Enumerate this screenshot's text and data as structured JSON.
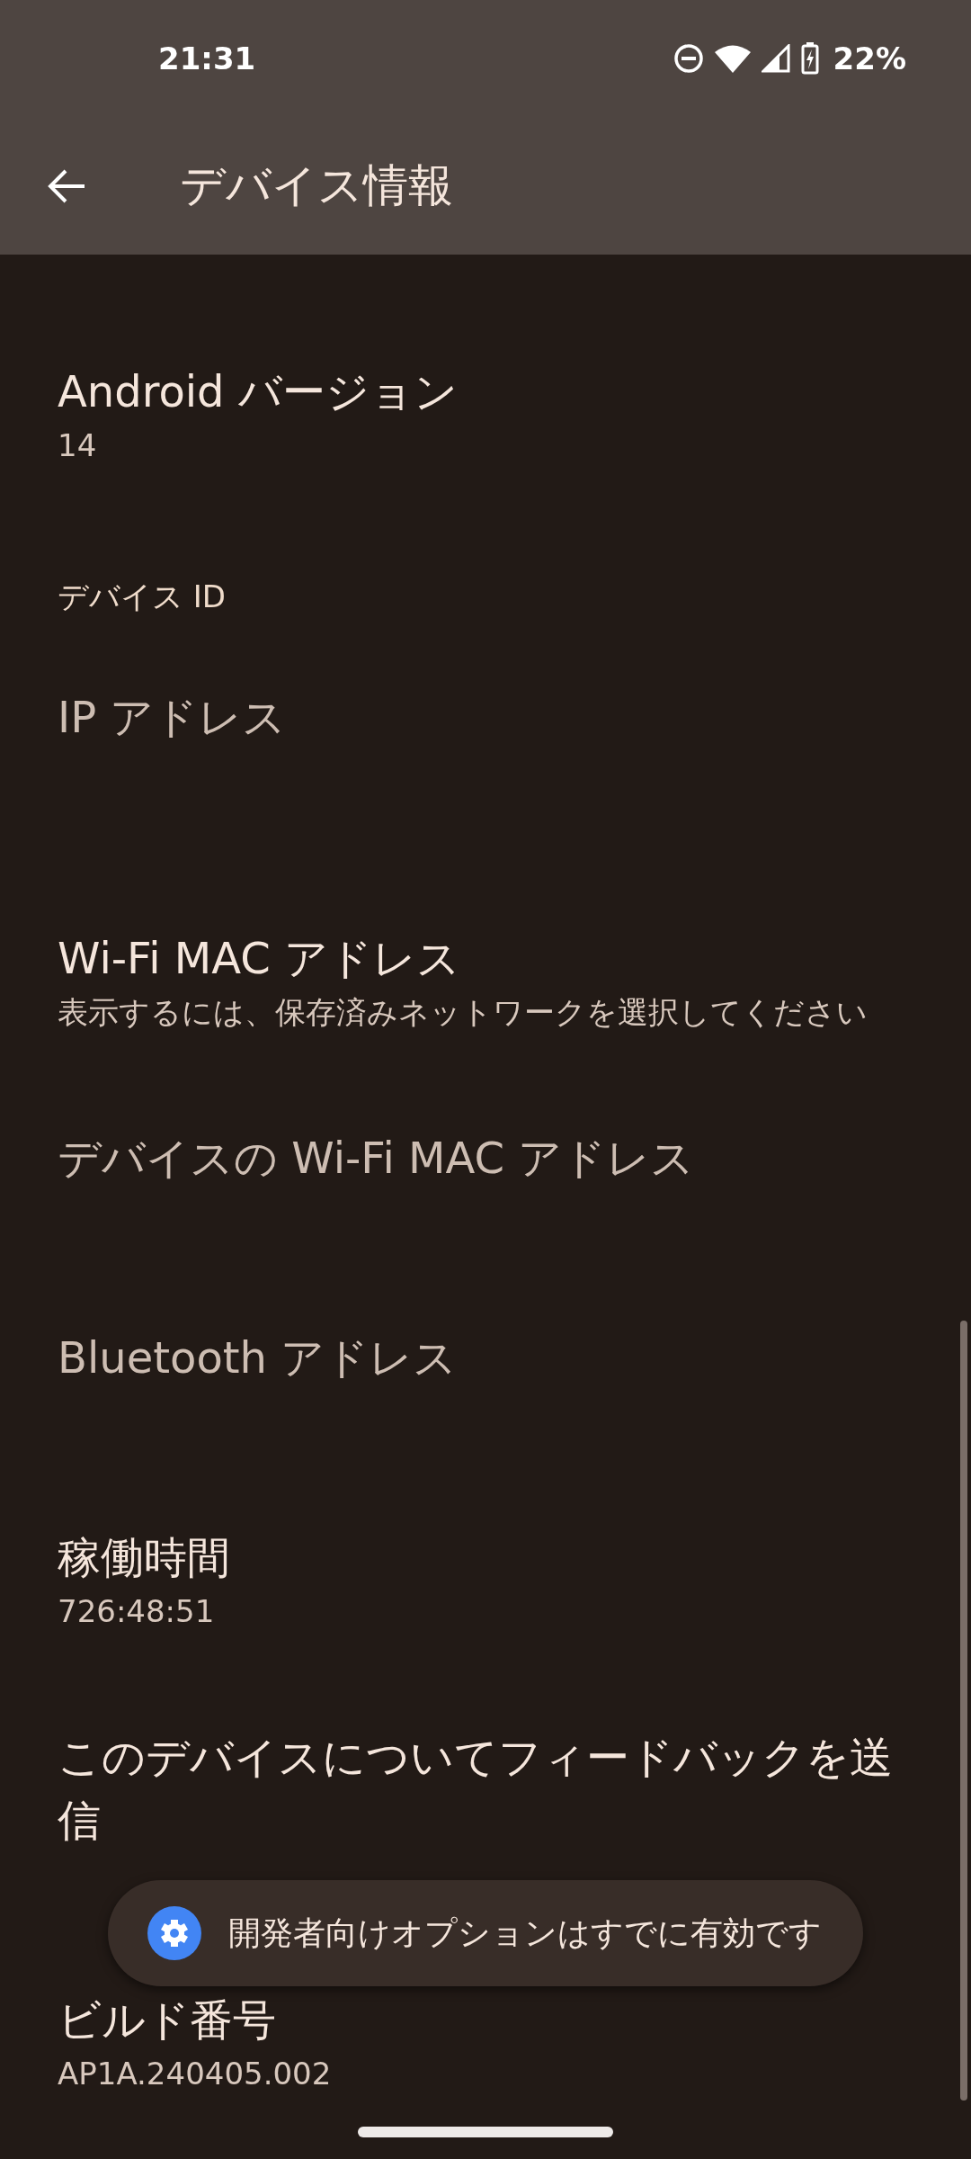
{
  "status_bar": {
    "time": "21:31",
    "battery": "22%"
  },
  "app_bar": {
    "title": "デバイス情報"
  },
  "sections": [
    {
      "items": [
        {
          "title": "Android バージョン",
          "summary": "14",
          "disabled": false
        }
      ]
    },
    {
      "header": "デバイス ID",
      "items": [
        {
          "title": "IP アドレス",
          "disabled": true
        },
        {
          "title": "Wi-Fi MAC アドレス",
          "summary": "表示するには、保存済みネットワークを選択してください",
          "disabled": false
        },
        {
          "title": "デバイスの Wi-Fi MAC アドレス",
          "disabled": true
        },
        {
          "title": "Bluetooth アドレス",
          "disabled": true
        },
        {
          "title": "稼働時間",
          "summary": "726:48:51",
          "disabled": false
        },
        {
          "title": "このデバイスについてフィードバックを送信",
          "disabled": false
        },
        {
          "title": "ビルド番号",
          "summary": "AP1A.240405.002",
          "disabled": false
        }
      ]
    }
  ],
  "toast": {
    "message": "開発者向けオプションはすでに有効です"
  }
}
